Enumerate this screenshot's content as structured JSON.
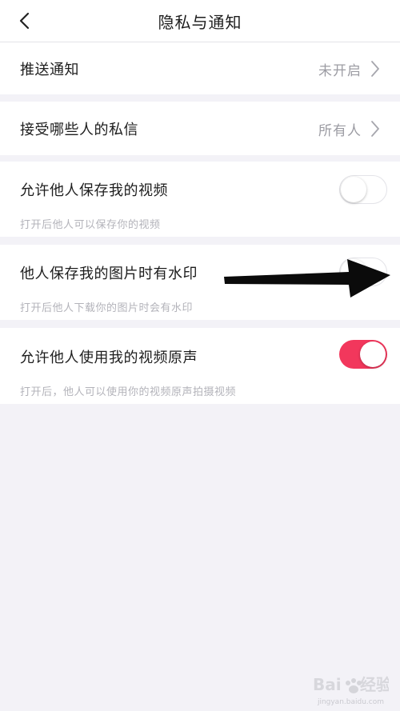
{
  "header": {
    "title": "隐私与通知",
    "back_icon": "chevron-left-icon"
  },
  "rows": {
    "push": {
      "label": "推送通知",
      "value": "未开启",
      "icon": "chevron-right-icon"
    },
    "messages": {
      "label": "接受哪些人的私信",
      "value": "所有人",
      "icon": "chevron-right-icon"
    },
    "save_video": {
      "label": "允许他人保存我的视频",
      "desc": "打开后他人可以保存你的视频",
      "toggle_on": false
    },
    "watermark": {
      "label": "他人保存我的图片时有水印",
      "desc": "打开后他人下载你的图片时会有水印",
      "toggle_on": false
    },
    "original_sound": {
      "label": "允许他人使用我的视频原声",
      "desc": "打开后，他人可以使用你的视频原声拍摄视频",
      "toggle_on": true
    }
  },
  "colors": {
    "toggle_on": "#f2375c",
    "background": "#f3f2f7",
    "secondary_text": "#9c9ca3"
  },
  "annotation": {
    "icon": "arrow-right-icon"
  },
  "watermark": {
    "logo": "Baidu 经验",
    "url": "jingyan.baidu.com"
  }
}
